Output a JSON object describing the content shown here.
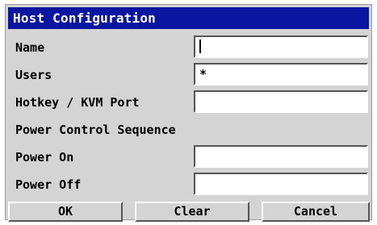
{
  "dialog": {
    "title": "Host Configuration",
    "fields": {
      "name": {
        "label": "Name",
        "value": ""
      },
      "users": {
        "label": "Users",
        "value": "*"
      },
      "hotkey": {
        "label": "Hotkey / KVM Port",
        "value": ""
      }
    },
    "section_label": "Power Control Sequence",
    "power": {
      "on": {
        "label": "Power On",
        "value": ""
      },
      "off": {
        "label": "Power Off",
        "value": ""
      }
    },
    "buttons": {
      "ok": "OK",
      "clear": "Clear",
      "cancel": "Cancel"
    }
  },
  "colors": {
    "title_bar": "#0a16a0",
    "dialog_bg": "#d4d4d4"
  }
}
